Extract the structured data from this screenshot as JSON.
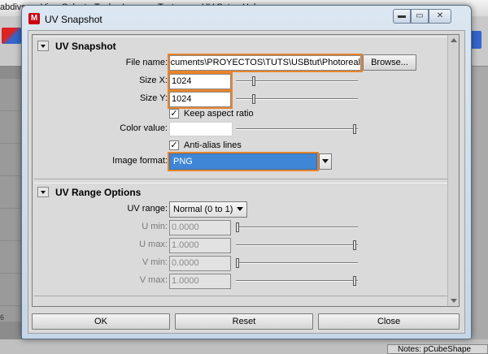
{
  "background": {
    "menu": [
      "abdivs",
      "View",
      "Select",
      "Tool",
      "Image",
      "Textures",
      "UV Sets",
      "Help"
    ],
    "ruler": "6",
    "notes": "Notes:  pCubeShape"
  },
  "window": {
    "title": "UV Snapshot",
    "icon_char": "M",
    "min_glyph": "▬",
    "max_glyph": "▭",
    "close_glyph": "✕"
  },
  "uv_snapshot": {
    "title": "UV Snapshot",
    "file_name_label": "File name:",
    "file_name_value": "Documents\\PROYECTOS\\TUTS\\USBtut\\Photoreal",
    "browse_label": "Browse...",
    "size_x_label": "Size X:",
    "size_x_value": "1024",
    "size_y_label": "Size Y:",
    "size_y_value": "1024",
    "keep_aspect_label": "Keep aspect ratio",
    "keep_aspect_checked": "✓",
    "color_value_label": "Color value:",
    "antialias_label": "Anti-alias lines",
    "antialias_checked": "✓",
    "image_format_label": "Image format:",
    "image_format_value": "PNG"
  },
  "uv_range": {
    "title": "UV Range Options",
    "uv_range_label": "UV range:",
    "uv_range_value": "Normal (0 to 1)",
    "u_min_label": "U min:",
    "u_min_value": "0.0000",
    "u_max_label": "U max:",
    "u_max_value": "1.0000",
    "v_min_label": "V min:",
    "v_min_value": "0.0000",
    "v_max_label": "V max:",
    "v_max_value": "1.0000"
  },
  "buttons": {
    "ok": "OK",
    "reset": "Reset",
    "close": "Close"
  },
  "colors": {
    "highlight": "#e8842a",
    "title_bar": "#c5d6e8"
  }
}
